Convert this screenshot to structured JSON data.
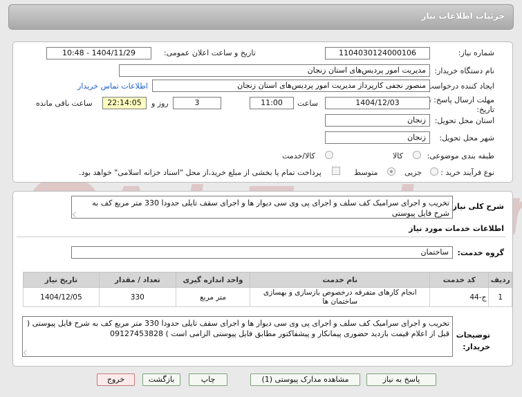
{
  "window": {
    "title": "جزئیات اطلاعات نیاز"
  },
  "watermark": {
    "text": "AriaTender.net"
  },
  "form": {
    "need_number_label": "شماره نیاز:",
    "need_number": "1104030124000106",
    "announce_label": "تاریخ و ساعت اعلان عمومی:",
    "announce_value": "1404/11/29 - 10:48",
    "buyer_label": "نام دستگاه خریدار:",
    "buyer_value": "مدیریت امور پردیس‌های استان زنجان",
    "creator_label": "ایجاد کننده درخواست:",
    "creator_value": "منصور نجفی کارپرداز  مدیریت امور پردیس‌های استان زنجان",
    "contact_link": "اطلاعات تماس خریدار",
    "deadline_label": "مهلت ارسال پاسخ: تا تاریخ:",
    "deadline_date": "1404/12/03",
    "time_label": "ساعت",
    "deadline_time": "11:00",
    "days_value": "3",
    "days_label": "روز و",
    "remaining_time": "22:14:05",
    "remaining_label": "ساعت باقی مانده",
    "province_label": "استان محل تحویل:",
    "province_value": "زنجان",
    "city_label": "شهر محل تحویل:",
    "city_value": "زنجان",
    "category_label": "طبقه بندی موضوعی:",
    "category_options": [
      "کالا",
      "کالا/خدمت"
    ],
    "process_label": "نوع فرآیند خرید :",
    "process_options": [
      "جزیی",
      "متوسط"
    ],
    "payment_note": "پرداخت تمام یا بخشی از مبلغ خرید،از محل \"اسناد خزانه اسلامی\" خواهد بود."
  },
  "description": {
    "label": "شرح کلی نیاز:",
    "text": "تخریب و اجرای سرامیک کف سلف و اجرای پی وی سی دیوار ها و اجرای سقف تایلی حدودا 330 متر مربع کف به شرح  فایل پیوستی"
  },
  "services": {
    "section_title": "اطلاعات خدمات مورد نیاز",
    "group_label": "گروه خدمت:",
    "group_value": "ساختمان",
    "columns": [
      "ردیف",
      "کد خدمت",
      "نام خدمت",
      "واحد اندازه گیری",
      "تعداد / مقدار",
      "تاریخ نیاز"
    ],
    "rows": [
      [
        "1",
        "ج-44",
        "انجام کارهای متفرقه درخصوص بازسازی و بهسازی ساختمان ها",
        "متر مربع",
        "330",
        "1404/12/05"
      ]
    ]
  },
  "buyer_notes": {
    "label_line1": "توضیحات",
    "label_line2": "خریدار:",
    "text": "تخریب و اجرای سرامیک کف سلف و اجرای پی وی سی دیوار ها و اجرای سقف تایلی حدودا 330 متر مربع کف به شرح  فایل پیوستی ( قبل از اعلام قیمت بازدید حضوری پیمانکار و پیشفاکتور مطابق فایل پیوستی الزامی است ) 09127453828"
  },
  "buttons": {
    "reply": "پاسخ به نیاز",
    "attachments": "مشاهده مدارک پیوستی (1)",
    "print": "چاپ",
    "back": "بازگشت",
    "exit": "خروج"
  }
}
